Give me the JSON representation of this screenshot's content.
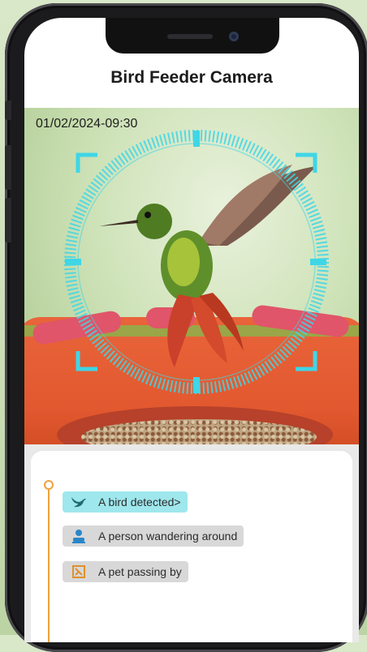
{
  "app": {
    "title": "Bird Feeder Camera"
  },
  "camera": {
    "timestamp": "01/02/2024-09:30"
  },
  "events": [
    {
      "label": "A bird detected>",
      "icon": "bird-icon",
      "highlighted": true
    },
    {
      "label": "A person wandering around",
      "icon": "person-icon",
      "highlighted": false
    },
    {
      "label": "A pet passing by",
      "icon": "pet-icon",
      "highlighted": false
    }
  ],
  "colors": {
    "accent_cyan": "#3fd6e6",
    "timeline_orange": "#f0a13c",
    "feeder_orange": "#e2582f"
  }
}
